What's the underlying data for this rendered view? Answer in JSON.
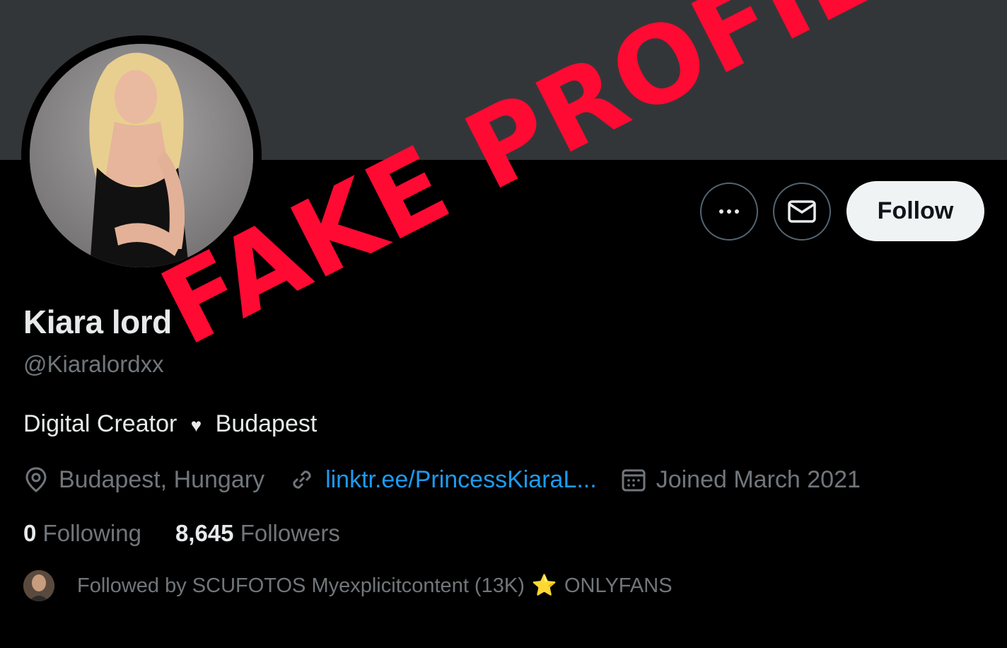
{
  "profile": {
    "display_name": "Kiara lord",
    "handle": "@Kiaralordxx",
    "bio_part1": "Digital Creator",
    "bio_part2": "Budapest",
    "location": "Budapest, Hungary",
    "website": "linktr.ee/PrincessKiaraL...",
    "joined": "Joined March 2021"
  },
  "actions": {
    "follow_label": "Follow",
    "more_icon": "more-icon",
    "message_icon": "envelope-icon"
  },
  "stats": {
    "following_count": "0",
    "following_label": "Following",
    "followers_count": "8,645",
    "followers_label": "Followers"
  },
  "followed_by": {
    "text": "Followed by SCUFOTOS Myexplicitcontent (13K)",
    "emoji": "⭐",
    "text2": "ONLYFANS"
  },
  "overlay": {
    "stamp_text": "FAKE PROFIL",
    "stamp_color": "#ff0a33"
  },
  "colors": {
    "banner": "#333639",
    "link": "#1d9bf0",
    "muted": "#71767b"
  }
}
